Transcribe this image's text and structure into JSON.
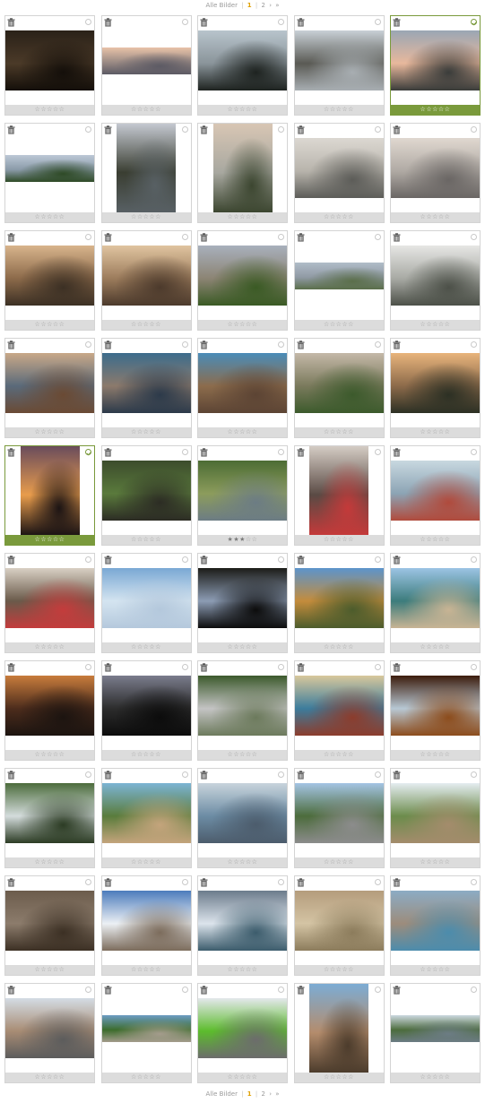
{
  "pager": {
    "label": "Alle Bilder",
    "separator": "|",
    "current_page": "1",
    "other_page": "2",
    "next": "›",
    "last": "»"
  },
  "colors": {
    "selected": "#7a9a3c",
    "rating_bar": "#dcdcdc",
    "border": "#d4d4d4"
  },
  "icons": {
    "trash": "trash-icon",
    "select": "select-circle-icon",
    "star": "star-icon"
  },
  "photos": [
    {
      "selected": false,
      "rating": 0,
      "orient": "land",
      "colors": [
        "#2a2118",
        "#4b3a28",
        "#140f0a"
      ]
    },
    {
      "selected": false,
      "rating": 0,
      "orient": "wide",
      "colors": [
        "#e8c2a8",
        "#9a8a84",
        "#5c5a64"
      ]
    },
    {
      "selected": false,
      "rating": 0,
      "orient": "land",
      "colors": [
        "#b8c4cc",
        "#8a949a",
        "#1e2320"
      ]
    },
    {
      "selected": false,
      "rating": 0,
      "orient": "land",
      "colors": [
        "#c8d0d6",
        "#5a5a54",
        "#a8aeb2"
      ]
    },
    {
      "selected": true,
      "rating": 0,
      "orient": "land",
      "colors": [
        "#9aa6b4",
        "#e8b89c",
        "#3a3c3a"
      ]
    },
    {
      "selected": false,
      "rating": 0,
      "orient": "wide",
      "colors": [
        "#bcc8d6",
        "#8a9aa8",
        "#2e4a26"
      ]
    },
    {
      "selected": false,
      "rating": 0,
      "orient": "port",
      "colors": [
        "#c4c8d0",
        "#3a3e32",
        "#586064"
      ]
    },
    {
      "selected": false,
      "rating": 0,
      "orient": "port",
      "colors": [
        "#d8c6b4",
        "#a8a8a0",
        "#3c4630"
      ]
    },
    {
      "selected": false,
      "rating": 0,
      "orient": "land",
      "colors": [
        "#dcd8d2",
        "#b8b4ac",
        "#5c5c58"
      ]
    },
    {
      "selected": false,
      "rating": 0,
      "orient": "land",
      "colors": [
        "#e0d8d0",
        "#b0aaa4",
        "#6a6664"
      ]
    },
    {
      "selected": false,
      "rating": 0,
      "orient": "land",
      "colors": [
        "#d8b48c",
        "#8c6a4a",
        "#3c3024"
      ]
    },
    {
      "selected": false,
      "rating": 0,
      "orient": "land",
      "colors": [
        "#e0c4a0",
        "#9c7c5c",
        "#4c3a2c"
      ]
    },
    {
      "selected": false,
      "rating": 0,
      "orient": "land",
      "colors": [
        "#a8b0bc",
        "#8c8474",
        "#3a5a24"
      ]
    },
    {
      "selected": false,
      "rating": 0,
      "orient": "wide",
      "colors": [
        "#b0bcc8",
        "#909aa4",
        "#5a6e4a"
      ]
    },
    {
      "selected": false,
      "rating": 0,
      "orient": "land",
      "colors": [
        "#e6e6e4",
        "#a8aaa4",
        "#4c5048"
      ]
    },
    {
      "selected": false,
      "rating": 0,
      "orient": "land",
      "colors": [
        "#c8a888",
        "#5a6a7a",
        "#6a4a34"
      ]
    },
    {
      "selected": false,
      "rating": 0,
      "orient": "land",
      "colors": [
        "#3c6c8c",
        "#8c7a6c",
        "#2c3a4a"
      ]
    },
    {
      "selected": false,
      "rating": 0,
      "orient": "land",
      "colors": [
        "#4a8cb8",
        "#8c6c4c",
        "#5c4434"
      ]
    },
    {
      "selected": false,
      "rating": 0,
      "orient": "land",
      "colors": [
        "#c4b8a8",
        "#7a7a5c",
        "#3c5a2c"
      ]
    },
    {
      "selected": false,
      "rating": 0,
      "orient": "land",
      "colors": [
        "#e8b47c",
        "#8c6a4a",
        "#2c3024"
      ]
    },
    {
      "selected": true,
      "rating": 0,
      "orient": "port",
      "colors": [
        "#6a4c5c",
        "#e89c4c",
        "#1c1414"
      ]
    },
    {
      "selected": false,
      "rating": 0,
      "orient": "land",
      "colors": [
        "#3c4c2c",
        "#5a7a3c",
        "#2c2c24"
      ]
    },
    {
      "selected": false,
      "rating": 3,
      "orient": "land",
      "colors": [
        "#4c6c34",
        "#8c9c5c",
        "#6c7c84"
      ]
    },
    {
      "selected": false,
      "rating": 0,
      "orient": "port",
      "colors": [
        "#d4ccc4",
        "#5a4a44",
        "#c43a3a"
      ]
    },
    {
      "selected": false,
      "rating": 0,
      "orient": "land",
      "colors": [
        "#c8d8e0",
        "#8ca4b4",
        "#b04a3c"
      ]
    },
    {
      "selected": false,
      "rating": 0,
      "orient": "land",
      "colors": [
        "#d8d0c4",
        "#6a5a4a",
        "#c43c3c"
      ]
    },
    {
      "selected": false,
      "rating": 0,
      "orient": "land",
      "colors": [
        "#7aa8d4",
        "#d4e4f0",
        "#b4c8dc"
      ]
    },
    {
      "selected": false,
      "rating": 0,
      "orient": "land",
      "colors": [
        "#1c1c18",
        "#8c9cb4",
        "#0c0c0c"
      ]
    },
    {
      "selected": false,
      "rating": 0,
      "orient": "land",
      "colors": [
        "#5c94cc",
        "#c48c3c",
        "#4c5c2c"
      ]
    },
    {
      "selected": false,
      "rating": 0,
      "orient": "land",
      "colors": [
        "#9cc4e4",
        "#3c7c7c",
        "#c8b494"
      ]
    },
    {
      "selected": false,
      "rating": 0,
      "orient": "land",
      "colors": [
        "#c87c3c",
        "#4c2c1c",
        "#1c1410"
      ]
    },
    {
      "selected": false,
      "rating": 0,
      "orient": "land",
      "colors": [
        "#7a7c8c",
        "#2c2c2c",
        "#0c0c0c"
      ]
    },
    {
      "selected": false,
      "rating": 0,
      "orient": "land",
      "colors": [
        "#3c5a2c",
        "#c4c4c4",
        "#6c7a5c"
      ]
    },
    {
      "selected": false,
      "rating": 0,
      "orient": "land",
      "colors": [
        "#d8c89c",
        "#3c7c9c",
        "#8c3c2c"
      ]
    },
    {
      "selected": false,
      "rating": 0,
      "orient": "land",
      "colors": [
        "#3c1c0c",
        "#b8c8d4",
        "#8c4c1c"
      ]
    },
    {
      "selected": false,
      "rating": 0,
      "orient": "land",
      "colors": [
        "#4c6c3c",
        "#d4dcdc",
        "#2c3c24"
      ]
    },
    {
      "selected": false,
      "rating": 0,
      "orient": "land",
      "colors": [
        "#7cb4d4",
        "#5a7c3c",
        "#c4a47c"
      ]
    },
    {
      "selected": false,
      "rating": 0,
      "orient": "land",
      "colors": [
        "#c8d4dc",
        "#6c8ca4",
        "#4c5c6c"
      ]
    },
    {
      "selected": false,
      "rating": 0,
      "orient": "land",
      "colors": [
        "#a4c4e4",
        "#4c6c3c",
        "#8c8c8c"
      ]
    },
    {
      "selected": false,
      "rating": 0,
      "orient": "land",
      "colors": [
        "#e4ecf0",
        "#6c8c4c",
        "#a48c6c"
      ]
    },
    {
      "selected": false,
      "rating": 0,
      "orient": "land",
      "colors": [
        "#6c5c4c",
        "#8c7c6c",
        "#3c3024"
      ]
    },
    {
      "selected": false,
      "rating": 0,
      "orient": "land",
      "colors": [
        "#4c7cbc",
        "#ecf0f4",
        "#7c6c5c"
      ]
    },
    {
      "selected": false,
      "rating": 0,
      "orient": "land",
      "colors": [
        "#6c7c8c",
        "#dce4ec",
        "#3c5c6c"
      ]
    },
    {
      "selected": false,
      "rating": 0,
      "orient": "land",
      "colors": [
        "#b49c7c",
        "#d4c4a4",
        "#8c7c5c"
      ]
    },
    {
      "selected": false,
      "rating": 0,
      "orient": "land",
      "colors": [
        "#8cacc4",
        "#9c8c7c",
        "#4c8cac"
      ]
    },
    {
      "selected": false,
      "rating": 0,
      "orient": "land",
      "colors": [
        "#d4dce4",
        "#a88c74",
        "#5c5c5c"
      ]
    },
    {
      "selected": false,
      "rating": 0,
      "orient": "wide",
      "colors": [
        "#6c9cc4",
        "#3c6c2c",
        "#a49c8c"
      ]
    },
    {
      "selected": false,
      "rating": 0,
      "orient": "land",
      "colors": [
        "#e4e8ec",
        "#5cbc2c",
        "#6c6c6c"
      ]
    },
    {
      "selected": false,
      "rating": 0,
      "orient": "port",
      "colors": [
        "#7cacd4",
        "#b48c6c",
        "#4c3c2c"
      ]
    },
    {
      "selected": false,
      "rating": 0,
      "orient": "wide",
      "colors": [
        "#ccd8e0",
        "#4c6c3c",
        "#6c7c84"
      ]
    }
  ]
}
